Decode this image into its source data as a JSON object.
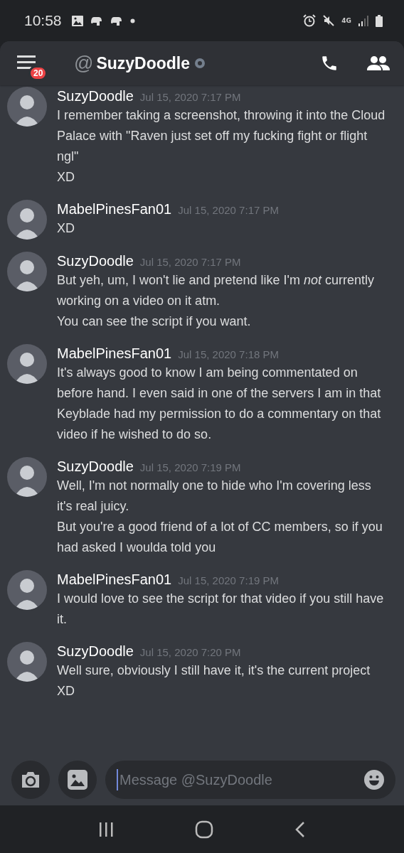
{
  "status_bar": {
    "time": "10:58",
    "network": "4G"
  },
  "header": {
    "badge": "20",
    "at": "@",
    "title": "SuzyDoodle",
    "online": false
  },
  "messages": [
    {
      "author": "SuzyDoodle",
      "time": "Jul 15, 2020 7:17 PM",
      "lines": [
        "I remember taking a screenshot, throwing it into the Cloud Palace with \"Raven just set off my fucking fight or flight ngl\"",
        "XD"
      ]
    },
    {
      "author": "MabelPinesFan01",
      "time": "Jul 15, 2020 7:17 PM",
      "lines": [
        "XD"
      ]
    },
    {
      "author": "SuzyDoodle",
      "time": "Jul 15, 2020 7:17 PM",
      "lines": [
        "But yeh, um, I won't lie and pretend like I'm *not* currently working on a video on it atm.",
        "You can see the script if you want."
      ]
    },
    {
      "author": "MabelPinesFan01",
      "time": "Jul 15, 2020 7:18 PM",
      "lines": [
        "It's always good to know I am being commentated on before hand. I even said in one of the servers I am in that Keyblade had my permission to do a commentary on that video if he wished to do so."
      ]
    },
    {
      "author": "SuzyDoodle",
      "time": "Jul 15, 2020 7:19 PM",
      "lines": [
        "Well, I'm not normally one to hide who I'm covering less it's real juicy.",
        "But you're a good friend of a lot of CC members, so if you had asked I woulda told you"
      ]
    },
    {
      "author": "MabelPinesFan01",
      "time": "Jul 15, 2020 7:19 PM",
      "lines": [
        "I would love to see the script for that video if you still have it."
      ]
    },
    {
      "author": "SuzyDoodle",
      "time": "Jul 15, 2020 7:20 PM",
      "lines": [
        "Well sure, obviously I still have it, it's the current project XD"
      ]
    }
  ],
  "composer": {
    "placeholder": "Message @SuzyDoodle"
  }
}
